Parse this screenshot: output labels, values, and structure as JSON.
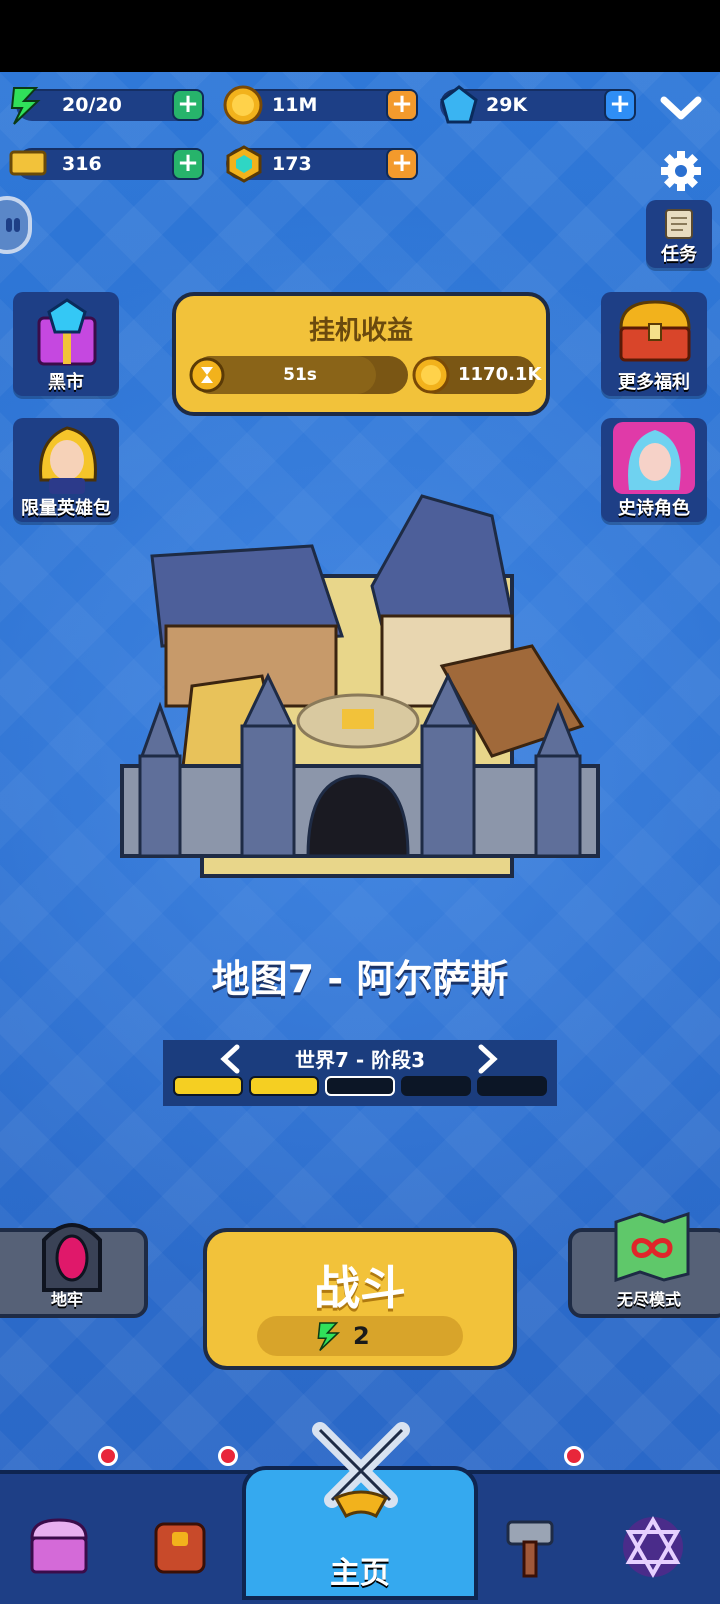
{
  "resources": {
    "energy": {
      "value": "20/20",
      "icon": "lightning-icon"
    },
    "gold": {
      "value": "11M",
      "icon": "gold-coin-icon"
    },
    "gems": {
      "value": "29K",
      "icon": "blue-gem-icon"
    },
    "tickets": {
      "value": "316",
      "icon": "ticket-icon"
    },
    "crystals": {
      "value": "173",
      "icon": "teal-crystal-icon"
    }
  },
  "top_right": {
    "task_label": "任务"
  },
  "left_buttons": [
    {
      "label": "黑市",
      "icon": "gift-box-icon"
    },
    {
      "label": "限量英雄包",
      "icon": "hero-portrait-icon"
    }
  ],
  "right_buttons": [
    {
      "label": "更多福利",
      "icon": "treasure-chest-icon"
    },
    {
      "label": "史诗角色",
      "icon": "elf-portrait-icon"
    }
  ],
  "idle_income": {
    "title": "挂机收益",
    "timer": "51s",
    "gold": "1170.1K",
    "progress": 0.85
  },
  "map": {
    "title": "地图7 - 阿尔萨斯"
  },
  "stage": {
    "label": "世界7 - 阶段3",
    "segments": [
      "done",
      "done",
      "current",
      "locked",
      "locked"
    ]
  },
  "modes": {
    "dungeon": "地牢",
    "endless": "无尽模式"
  },
  "fight": {
    "label": "战斗",
    "cost": "2"
  },
  "nav": {
    "home_label": "主页"
  },
  "colors": {
    "accent": "#f2c23a",
    "panel": "#1e3f86",
    "background": "#2f78d8"
  }
}
